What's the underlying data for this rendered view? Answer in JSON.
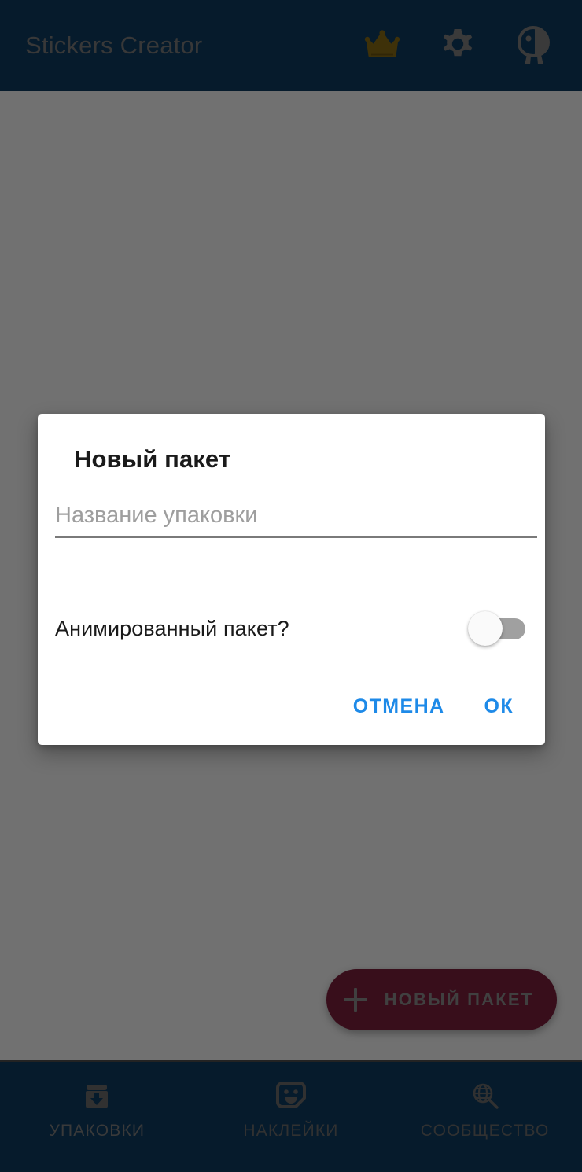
{
  "app": {
    "title": "Stickers Creator",
    "topbar_bg": "#0e3d63",
    "scrim_color": "#5c5c5c"
  },
  "topbar": {
    "title": "Stickers Creator",
    "actions": [
      {
        "name": "crown-icon",
        "label": "Premium",
        "color": "#8a6d15"
      },
      {
        "name": "gear-icon",
        "label": "Settings",
        "color": "#808080"
      },
      {
        "name": "bird-icon",
        "label": "Mascot",
        "color": "#808080"
      }
    ]
  },
  "fab": {
    "label": "НОВЫЙ ПАКЕТ",
    "icon": "plus-icon",
    "bg": "#7c1f3d",
    "fg": "#8e8e8e"
  },
  "bottom_nav": {
    "items": [
      {
        "label": "УПАКОВКИ",
        "icon": "archive-download-icon",
        "selected": true
      },
      {
        "label": "НАКЛЕЙКИ",
        "icon": "sticker-face-icon",
        "selected": false
      },
      {
        "label": "СООБЩЕСТВО",
        "icon": "globe-search-icon",
        "selected": false
      }
    ]
  },
  "dialog": {
    "title": "Новый пакет",
    "input": {
      "placeholder": "Название упаковки",
      "value": ""
    },
    "switch": {
      "label": "Анимированный пакет?",
      "state": "off"
    },
    "buttons": {
      "cancel": "ОТМЕНА",
      "ok": "ОК",
      "color": "#1e8ae8"
    }
  }
}
